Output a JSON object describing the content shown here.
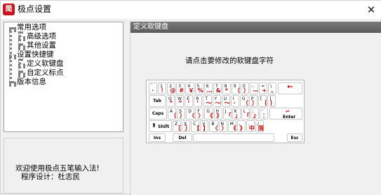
{
  "window": {
    "title": "极点设置",
    "icon_text": "简",
    "close_glyph": "✕"
  },
  "tree": {
    "n1": "常用选项",
    "n1a": "高级选项",
    "n1b": "其他设置",
    "n2": "设置快捷键",
    "n2a": "定义软键盘",
    "n2b": "自定义标点",
    "n3": "版本信息"
  },
  "welcome": {
    "line1": "欢迎使用极点五笔输入法!",
    "line2": "程序设计：杜志民"
  },
  "panel": {
    "header": "定义软键盘",
    "instruction": "请点击要修改的软键盘字符"
  },
  "keyboard": {
    "row1": [
      {
        "top": "`",
        "bot": "·"
      },
      {
        "top": "1",
        "bot": "！"
      },
      {
        "top": "2",
        "bot": "@"
      },
      {
        "top": "3",
        "bot": "#"
      },
      {
        "top": "4",
        "bot": "￥"
      },
      {
        "top": "5",
        "bot": "%"
      },
      {
        "top": "6",
        "bot": "…"
      },
      {
        "top": "7",
        "bot": "&"
      },
      {
        "top": "8",
        "bot": "*"
      },
      {
        "top": "9",
        "bot": "（"
      },
      {
        "top": "0",
        "bot": "）"
      },
      {
        "top": "-",
        "bot": "—"
      },
      {
        "top": "=",
        "bot": "+"
      },
      {
        "top": "\\",
        "bot": "、"
      }
    ],
    "row2": [
      {
        "top": "Q",
        "bot": "“"
      },
      {
        "top": "W",
        "bot": "”"
      },
      {
        "top": "E",
        "bot": "‘"
      },
      {
        "top": "R",
        "bot": "’"
      },
      {
        "top": "T",
        "bot": "～"
      },
      {
        "top": "Y",
        "bot": "～"
      },
      {
        "top": "U",
        "bot": "～"
      },
      {
        "top": "I",
        "bot": "·"
      },
      {
        "top": "O",
        "bot": "〔"
      },
      {
        "top": "P",
        "bot": "〕"
      },
      {
        "top": "[",
        "bot": "｛"
      },
      {
        "top": "]",
        "bot": "｝"
      }
    ],
    "row3": [
      {
        "top": "A",
        "bot": "（"
      },
      {
        "top": "S",
        "bot": "）"
      },
      {
        "top": "D",
        "bot": "〈"
      },
      {
        "top": "F",
        "bot": "〉"
      },
      {
        "top": "G",
        "bot": "《"
      },
      {
        "top": "H",
        "bot": "》"
      },
      {
        "top": "J",
        "bot": "「"
      },
      {
        "top": "K",
        "bot": "」"
      },
      {
        "top": "L",
        "bot": "『"
      },
      {
        "top": ";",
        "bot": "』"
      },
      {
        "top": "'",
        "bot": "："
      }
    ],
    "row4": [
      {
        "top": "Z",
        "bot": "〖"
      },
      {
        "top": "X",
        "bot": "〗"
      },
      {
        "top": "C",
        "bot": "【"
      },
      {
        "top": "V",
        "bot": "】"
      },
      {
        "top": "B",
        "bot": "〈"
      },
      {
        "top": "N",
        "bot": "〉"
      },
      {
        "top": "M",
        "bot": "《"
      },
      {
        "top": ",",
        "bot": "》"
      },
      {
        "top": ".",
        "bot": "中"
      },
      {
        "top": "/",
        "bot": "国"
      }
    ],
    "backspace": "←",
    "tab": "Tab",
    "caps": "Caps",
    "enter": "Enter",
    "enter_arrow": "↵",
    "shift": "Shift",
    "shift_arrow": "⬆",
    "ins": "Ins",
    "del": "Del",
    "esc": "Esc"
  }
}
